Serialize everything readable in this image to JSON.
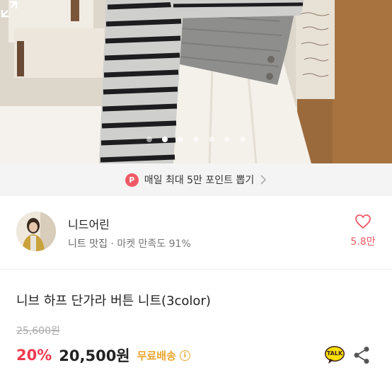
{
  "gallery": {
    "total_images": 7,
    "active_index": 1
  },
  "banner": {
    "badge": "P",
    "text": "매일 최대 5만 포인트 뽑기"
  },
  "seller": {
    "name": "니드어린",
    "tag": "니트 맛집",
    "separator": " · ",
    "satisfaction": "마켓 만족도 91%",
    "likes": "5.8만"
  },
  "product": {
    "title": "니브 하프 단가라 버튼 니트(3color)",
    "original_price": "25,600원",
    "discount": "20%",
    "price": "20,500원",
    "shipping": "무료배송",
    "info": "i",
    "talk_label": "TALK"
  },
  "colors": {
    "accent": "#ef3a4e",
    "badge": "#ef5a66",
    "shipping": "#e8a52d",
    "banner_bg": "#f4f4f4"
  }
}
